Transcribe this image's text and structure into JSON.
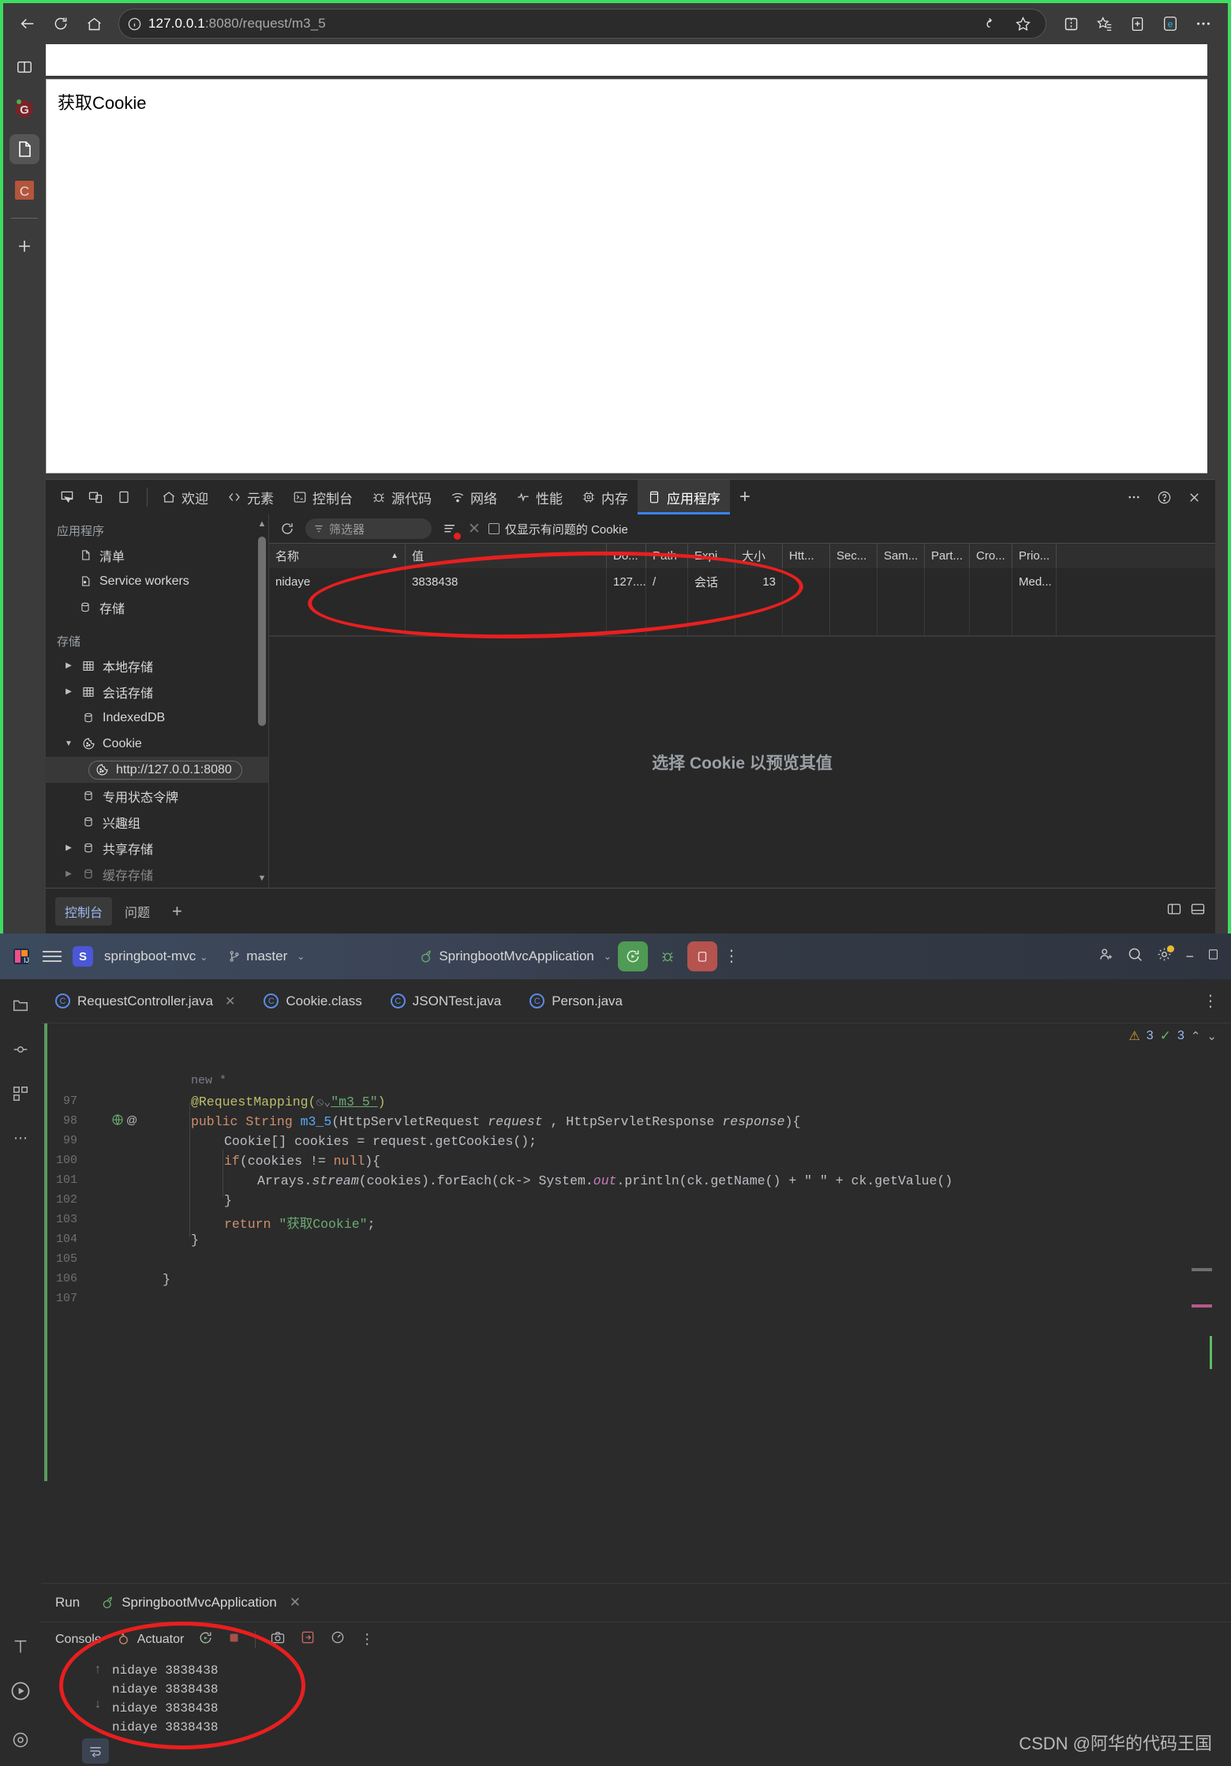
{
  "browser": {
    "address": {
      "host": "127.0.0.1",
      "rest": ":8080/request/m3_5"
    },
    "nav": {
      "back": "back-arrow",
      "refresh": "refresh",
      "home": "home"
    },
    "page_content": "获取Cookie",
    "rail_items": [
      "split-screen",
      "grammarly",
      "document",
      "collections",
      "add"
    ]
  },
  "devtools": {
    "device_buttons": [
      "inspect",
      "device-toolbar",
      "dock-side"
    ],
    "tabs": [
      {
        "label": "欢迎",
        "icon": "home-icon"
      },
      {
        "label": "元素",
        "icon": "code-icon"
      },
      {
        "label": "控制台",
        "icon": "terminal-icon"
      },
      {
        "label": "源代码",
        "icon": "bug-icon"
      },
      {
        "label": "网络",
        "icon": "wifi-icon"
      },
      {
        "label": "性能",
        "icon": "pulse-icon"
      },
      {
        "label": "内存",
        "icon": "chip-icon"
      },
      {
        "label": "应用程序",
        "icon": "app-icon",
        "active": true
      }
    ],
    "add_tab": "+",
    "right_buttons": [
      "more-options",
      "help",
      "close"
    ],
    "sidebar": {
      "section_app": "应用程序",
      "app_items": [
        {
          "label": "清单",
          "icon": "manifest-icon"
        },
        {
          "label": "Service workers",
          "icon": "service-worker-icon"
        },
        {
          "label": "存储",
          "icon": "storage-icon"
        }
      ],
      "section_storage": "存储",
      "storage_items": [
        {
          "label": "本地存储",
          "icon": "table-icon",
          "expandable": true
        },
        {
          "label": "会话存储",
          "icon": "table-icon",
          "expandable": true
        },
        {
          "label": "IndexedDB",
          "icon": "db-icon",
          "expandable": false
        },
        {
          "label": "Cookie",
          "icon": "cookie-icon",
          "expandable": true,
          "expanded": true
        },
        {
          "label": "http://127.0.0.1:8080",
          "icon": "cookie-icon",
          "selected": true
        },
        {
          "label": "专用状态令牌",
          "icon": "db-icon",
          "expandable": false
        },
        {
          "label": "兴趣组",
          "icon": "db-icon",
          "expandable": false
        },
        {
          "label": "共享存储",
          "icon": "db-icon",
          "expandable": true
        },
        {
          "label": "缓存存储",
          "icon": "db-icon",
          "expandable": true
        }
      ]
    },
    "cookie_toolbar": {
      "refresh": "refresh-icon",
      "filter_placeholder": "筛选器",
      "clear_all": "clear-all-icon",
      "delete": "delete-icon",
      "checkbox_label": "仅显示有问题的 Cookie"
    },
    "cookie_table": {
      "columns": [
        "名称",
        "值",
        "Do...",
        "Path",
        "Expi...",
        "大小",
        "Htt...",
        "Sec...",
        "Sam...",
        "Part...",
        "Cro...",
        "Prio..."
      ],
      "sorted_by": "名称",
      "rows": [
        {
          "name": "nidaye",
          "value": "3838438",
          "domain": "127....",
          "path": "/",
          "expires": "会话",
          "size": "13",
          "httponly": "",
          "secure": "",
          "samesite": "",
          "partition": "",
          "crosssite": "",
          "priority": "Med..."
        }
      ]
    },
    "preview_placeholder": "选择 Cookie 以预览其值",
    "drawer": {
      "tabs": [
        "控制台",
        "问题"
      ],
      "active_tab": "控制台",
      "add": "+"
    }
  },
  "ide": {
    "titlebar": {
      "project": "springboot-mvc",
      "branch": "master",
      "run_config": "SpringbootMvcApplication",
      "buttons": [
        "run-button",
        "debug-button",
        "stop-button",
        "more-button"
      ],
      "right_buttons": [
        "add-user-icon",
        "search-icon",
        "settings-icon",
        "minimize-icon",
        "maximize-icon"
      ]
    },
    "file_tabs": [
      {
        "label": "RequestController.java",
        "active": true,
        "closable": true
      },
      {
        "label": "Cookie.class",
        "active": false
      },
      {
        "label": "JSONTest.java",
        "active": false
      },
      {
        "label": "Person.java",
        "active": false
      }
    ],
    "inspection": {
      "warnings": "3",
      "passed": "3"
    },
    "code": {
      "hint_above": "new *",
      "lines": [
        {
          "num": "97",
          "indent": 1,
          "tokens": [
            {
              "t": "@RequestMapping(",
              "c": "ann"
            },
            {
              "t": "⦸⌄",
              "c": "hint"
            },
            {
              "t": "\"m3_5\"",
              "c": "str-u"
            },
            {
              "t": ")",
              "c": "ann"
            }
          ]
        },
        {
          "num": "98",
          "indent": 1,
          "marks": "globe-at",
          "tokens": [
            {
              "t": "public ",
              "c": "k"
            },
            {
              "t": "String ",
              "c": "k"
            },
            {
              "t": "m3_5",
              "c": "mth"
            },
            {
              "t": "(HttpServletRequest ",
              "c": "plain"
            },
            {
              "t": "request",
              "c": "ital2"
            },
            {
              "t": " , HttpServletResponse ",
              "c": "plain"
            },
            {
              "t": "response",
              "c": "ital2"
            },
            {
              "t": "){",
              "c": "plain"
            }
          ]
        },
        {
          "num": "99",
          "indent": 2,
          "tokens": [
            {
              "t": "Cookie[] cookies = request.getCookies();",
              "c": "plain"
            }
          ]
        },
        {
          "num": "100",
          "indent": 2,
          "tokens": [
            {
              "t": "if",
              "c": "k"
            },
            {
              "t": "(cookies != ",
              "c": "plain"
            },
            {
              "t": "null",
              "c": "k"
            },
            {
              "t": "){",
              "c": "plain"
            }
          ]
        },
        {
          "num": "101",
          "indent": 3,
          "tokens": [
            {
              "t": "Arrays.",
              "c": "plain"
            },
            {
              "t": "stream",
              "c": "ital2"
            },
            {
              "t": "(cookies).forEach(ck-> System.",
              "c": "plain"
            },
            {
              "t": "out",
              "c": "ital"
            },
            {
              "t": ".println(ck.getName() + \" \" + ck.getValue()",
              "c": "plain"
            }
          ]
        },
        {
          "num": "102",
          "indent": 2,
          "tokens": [
            {
              "t": "}",
              "c": "plain"
            }
          ]
        },
        {
          "num": "103",
          "indent": 2,
          "tokens": [
            {
              "t": "return ",
              "c": "k"
            },
            {
              "t": "\"获取Cookie\"",
              "c": "str"
            },
            {
              "t": ";",
              "c": "plain"
            }
          ]
        },
        {
          "num": "104",
          "indent": 1,
          "tokens": [
            {
              "t": "}",
              "c": "plain"
            }
          ]
        },
        {
          "num": "105",
          "indent": 0,
          "tokens": []
        },
        {
          "num": "106",
          "indent": 0,
          "tokens": [
            {
              "t": "}",
              "c": "plain"
            }
          ]
        },
        {
          "num": "107",
          "indent": 0,
          "tokens": []
        }
      ]
    },
    "run_window": {
      "label": "Run",
      "tab": "SpringbootMvcApplication",
      "toolbar": {
        "console": "Console",
        "actuator": "Actuator",
        "rerun": "rerun-icon",
        "stop": "stop-icon",
        "camera": "screenshot-icon",
        "export": "export-icon",
        "profile": "profiler-icon",
        "more": "more-icon"
      },
      "console_lines": [
        "nidaye 3838438",
        "nidaye 3838438",
        "nidaye 3838438",
        "nidaye 3838438"
      ]
    }
  },
  "watermark": "CSDN @阿华的代码王国",
  "colors": {
    "accent_green": "#3ddc60",
    "devtools_active_tab": "#3b82f6",
    "annotation_red": "#e81f1f",
    "ide_run_green": "#4f9a54",
    "ide_stop_red": "#b5534f"
  }
}
